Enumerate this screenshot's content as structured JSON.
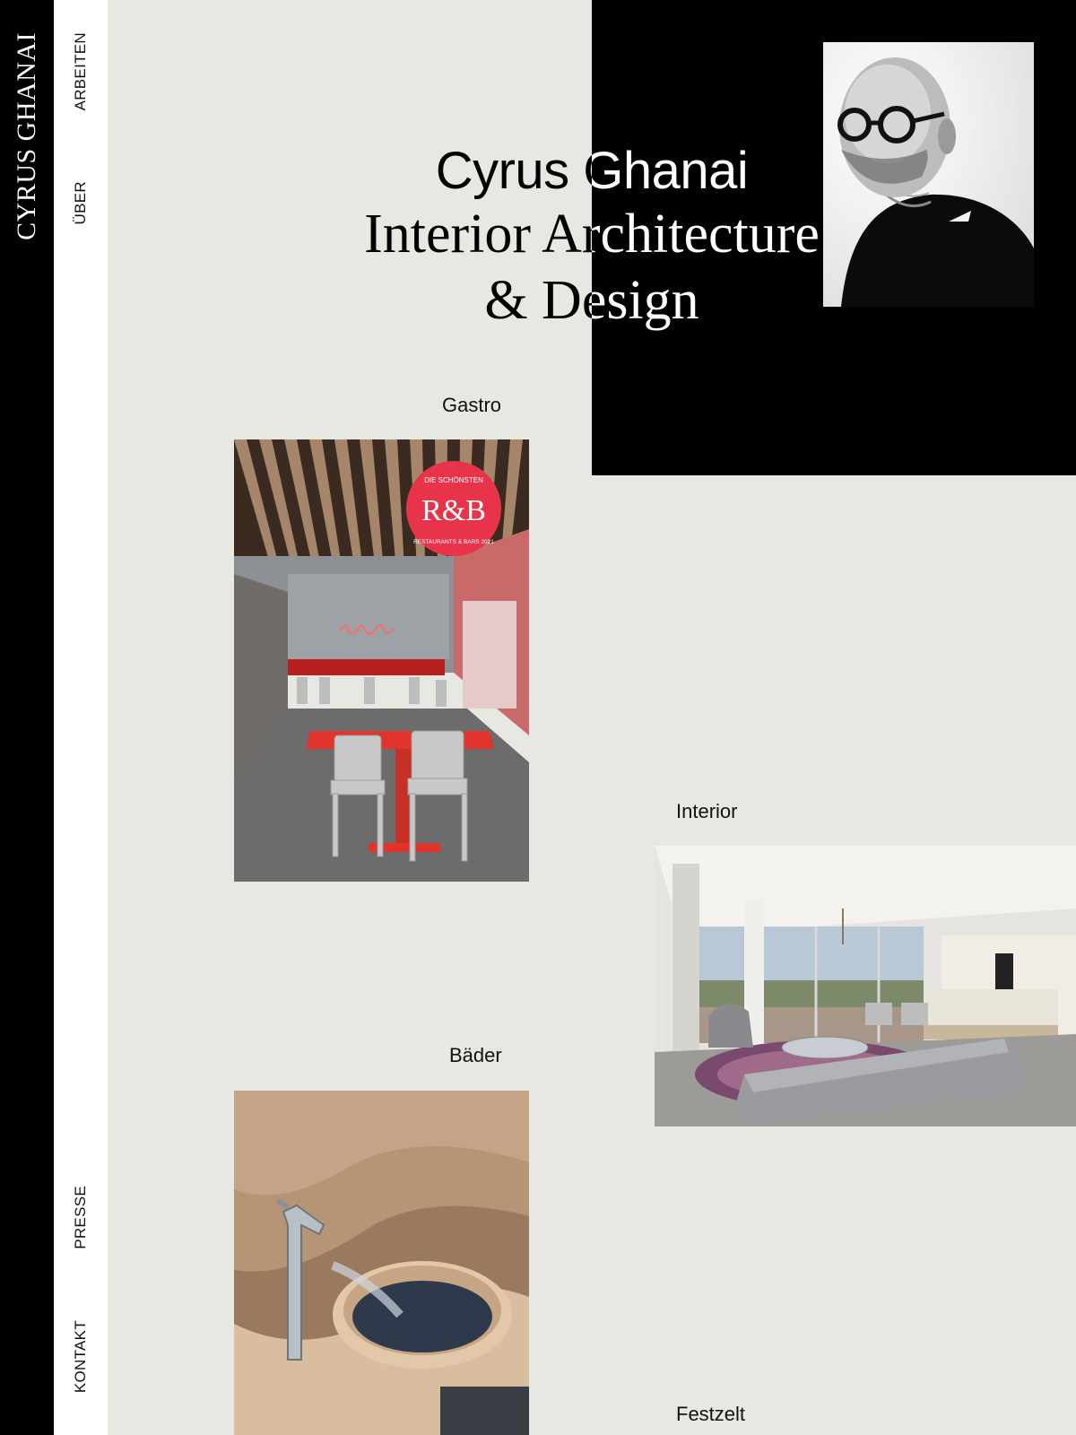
{
  "brand": {
    "name": "CYRUS GHANAI"
  },
  "nav": {
    "items": [
      {
        "label": "ARBEITEN"
      },
      {
        "label": "ÜBER"
      },
      {
        "label": "PRESSE"
      },
      {
        "label": "KONTAKT"
      }
    ]
  },
  "hero": {
    "name": "Cyrus Ghanai",
    "line1": "Interior Architecture",
    "line2": "& Design"
  },
  "categories": [
    {
      "label": "Gastro"
    },
    {
      "label": "Interior"
    },
    {
      "label": "Bäder"
    },
    {
      "label": "Festzelt"
    }
  ],
  "badge": {
    "top": "DIE SCHÖNSTEN",
    "mark": "R&B",
    "bottom": "RESTAURANTS & BARS 2021"
  },
  "colors": {
    "background": "#e8e8e3",
    "sidebar": "#000000",
    "nav": "#ffffff",
    "badge": "#e8344a",
    "neon": "#ff5a5a"
  }
}
